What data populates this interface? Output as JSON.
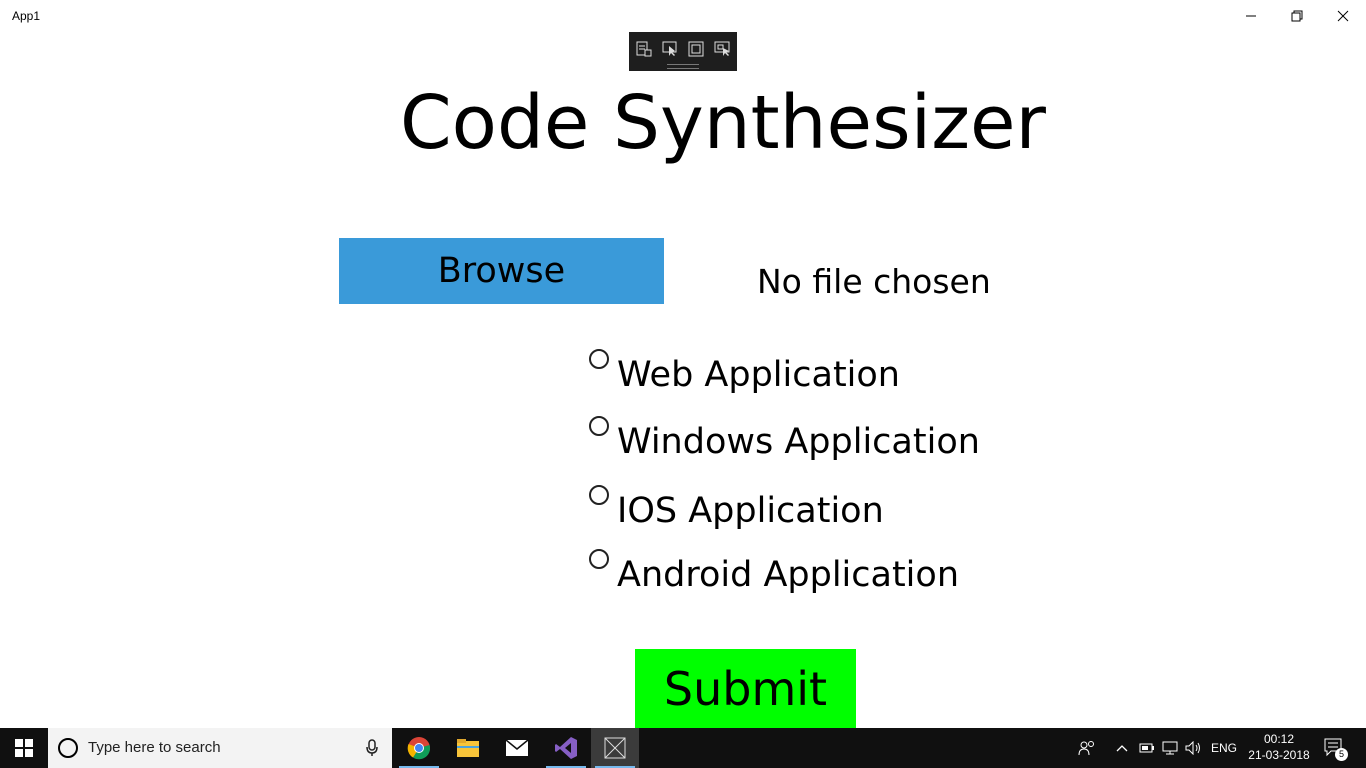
{
  "window": {
    "title": "App1",
    "controls": [
      "minimize",
      "restore",
      "close"
    ]
  },
  "debug_toolbar": {
    "tools": [
      "live-visual-tree-icon",
      "select-element-icon",
      "display-layout-adorners-icon",
      "track-focused-element-icon"
    ]
  },
  "main": {
    "heading": "Code Synthesizer",
    "browse_label": "Browse",
    "file_status": "No file chosen",
    "options": [
      {
        "label": "Web Application",
        "selected": false
      },
      {
        "label": "Windows Application",
        "selected": false
      },
      {
        "label": "IOS Application",
        "selected": false
      },
      {
        "label": "Android Application",
        "selected": false
      }
    ],
    "submit_label": "Submit"
  },
  "taskbar": {
    "search_placeholder": "Type here to search",
    "apps": [
      "chrome-icon",
      "file-explorer-icon",
      "mail-icon",
      "visual-studio-icon",
      "app1-icon"
    ],
    "language": "ENG",
    "time": "00:12",
    "date": "21-03-2018",
    "notification_count": "5"
  },
  "colors": {
    "browse_bg": "#3a9ad9",
    "submit_bg": "#00ff00",
    "taskbar_bg": "#101010"
  }
}
